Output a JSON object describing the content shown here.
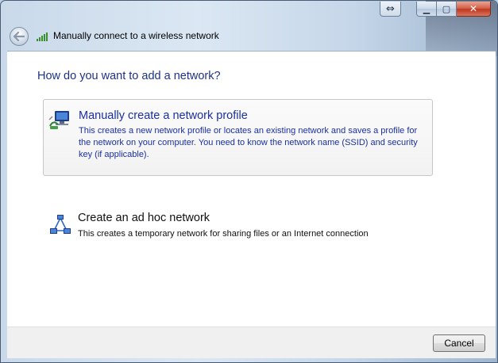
{
  "window": {
    "title": "Manually connect to a wireless network",
    "controls": {
      "minimize": "▁",
      "maximize": "▢",
      "close": "✕",
      "swap": "⇔"
    }
  },
  "icons": {
    "back": "arrow-left-icon",
    "signal": "wireless-signal-icon",
    "profile": "network-profile-icon",
    "adhoc": "adhoc-network-icon"
  },
  "main": {
    "heading": "How do you want to add a network?",
    "options": [
      {
        "title": "Manually create a network profile",
        "description": "This creates a new network profile or locates an existing network and saves a profile for the network on your computer. You need to know the network name (SSID) and security key (if applicable)."
      },
      {
        "title": "Create an ad hoc network",
        "description": "This creates a temporary network for sharing files or an Internet connection"
      }
    ]
  },
  "footer": {
    "cancel_label": "Cancel"
  },
  "colors": {
    "link_blue": "#1a30a0",
    "heading_blue": "#1e3287",
    "close_red": "#c0391f"
  }
}
